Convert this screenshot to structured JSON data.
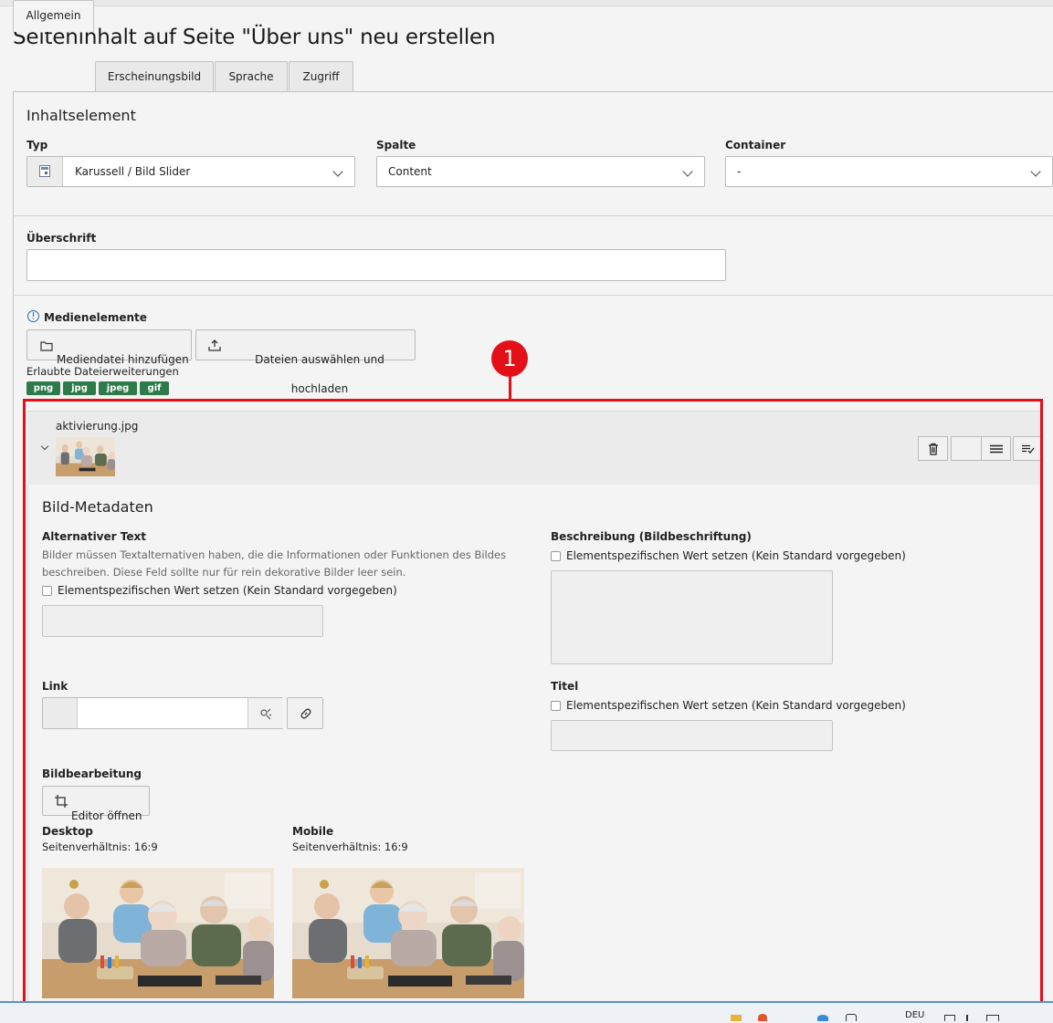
{
  "page": {
    "title": "Seiteninhalt auf Seite \"Über uns\" neu erstellen"
  },
  "tabs": [
    {
      "label": "Allgemein",
      "active": true
    },
    {
      "label": "Erscheinungsbild",
      "active": false
    },
    {
      "label": "Sprache",
      "active": false
    },
    {
      "label": "Zugriff",
      "active": false
    }
  ],
  "content_element": {
    "section_title": "Inhaltselement",
    "typ": {
      "label": "Typ",
      "value": "Karussell / Bild Slider"
    },
    "spalte": {
      "label": "Spalte",
      "value": "Content"
    },
    "container": {
      "label": "Container",
      "value": "-"
    }
  },
  "heading": {
    "label": "Überschrift",
    "value": ""
  },
  "media": {
    "label": "Medienelemente",
    "add_button": "Mediendatei hinzufügen",
    "upload_button": "Dateien auswählen und hochladen",
    "allowed_label": "Erlaubte Dateierweiterungen",
    "extensions": [
      "png",
      "jpg",
      "jpeg",
      "gif"
    ]
  },
  "file": {
    "name": "aktivierung.jpg",
    "metadata_title": "Bild-Metadaten",
    "alt": {
      "label": "Alternativer Text",
      "description": "Bilder müssen Textalternativen haben, die die Informationen oder Funktionen des Bildes beschreiben. Diese Feld sollte nur für rein dekorative Bilder leer sein.",
      "override": "Elementspezifischen Wert setzen (Kein Standard vorgegeben)"
    },
    "caption": {
      "label": "Beschreibung (Bildbeschriftung)",
      "override": "Elementspezifischen Wert setzen (Kein Standard vorgegeben)"
    },
    "link": {
      "label": "Link",
      "value": ""
    },
    "titel": {
      "label": "Titel",
      "override": "Elementspezifischen Wert setzen (Kein Standard vorgegeben)"
    },
    "editing": {
      "label": "Bildbearbeitung",
      "button": "Editor öffnen"
    },
    "desktop": {
      "label": "Desktop",
      "ratio": "Seitenverhältnis: 16:9"
    },
    "mobile": {
      "label": "Mobile",
      "ratio": "Seitenverhältnis: 16:9"
    }
  },
  "annotation": {
    "number": "1",
    "color": "#e31018"
  },
  "taskbar": {
    "lang": "DEU"
  },
  "colors": {
    "badge": "#2d7a4b",
    "accent": "#5b8fcf"
  }
}
